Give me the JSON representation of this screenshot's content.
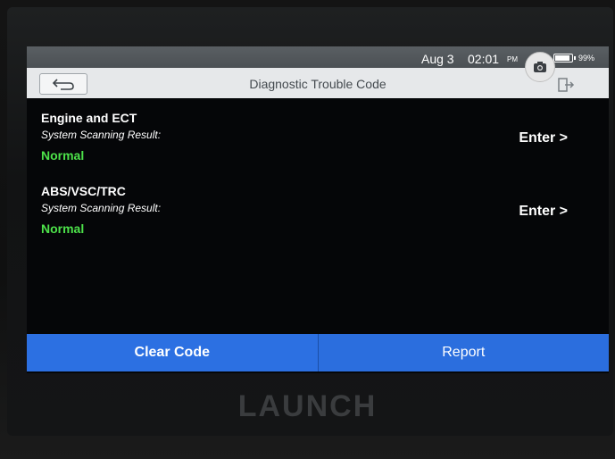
{
  "statusbar": {
    "date": "Aug 3",
    "time": "02:01",
    "ampm": "PM",
    "battery_level": 99,
    "battery_percent": "99%"
  },
  "header": {
    "title": "Diagnostic Trouble Code"
  },
  "results": [
    {
      "system": "Engine and ECT",
      "scan_label": "System Scanning Result:",
      "status": "Normal",
      "action": "Enter >"
    },
    {
      "system": "ABS/VSC/TRC",
      "scan_label": "System Scanning Result:",
      "status": "Normal",
      "action": "Enter >"
    }
  ],
  "footer": {
    "clear_label": "Clear Code",
    "report_label": "Report"
  },
  "brand": "LAUNCH",
  "colors": {
    "accent": "#2c70e2",
    "status_ok": "#4de24a",
    "titlebar": "#e6e8ea"
  },
  "icons": [
    "back-arrow-icon",
    "camera-icon",
    "exit-icon",
    "battery-icon"
  ]
}
